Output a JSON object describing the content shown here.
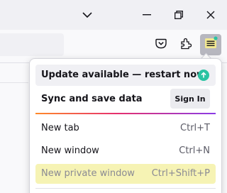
{
  "window_controls": {
    "items": [
      {
        "name": "list-all-tabs",
        "icon": "chevron-down-icon"
      },
      {
        "name": "minimize",
        "icon": "minimize-icon"
      },
      {
        "name": "restore",
        "icon": "restore-icon"
      },
      {
        "name": "close",
        "icon": "close-icon"
      }
    ]
  },
  "toolbar": {
    "buttons": [
      {
        "name": "pocket",
        "icon": "pocket-icon"
      },
      {
        "name": "extensions",
        "icon": "puzzle-icon"
      },
      {
        "name": "app-menu",
        "icon": "hamburger-menu-icon",
        "active": true,
        "badge_color": "#2ac3a2"
      }
    ]
  },
  "app_menu": {
    "update_label": "Update available — restart now",
    "sync_label": "Sync and save data",
    "sign_in_label": "Sign In",
    "items": [
      {
        "label": "New tab",
        "shortcut": "Ctrl+T",
        "highlighted": false
      },
      {
        "label": "New window",
        "shortcut": "Ctrl+N",
        "highlighted": false
      },
      {
        "label": "New private window",
        "shortcut": "Ctrl+Shift+P",
        "highlighted": true
      }
    ]
  },
  "colors": {
    "accent_update": "#2ac3a2",
    "highlight": "#f6f3b4",
    "active_button": "#b7b7bf",
    "gradient_start": "#ff8a2a",
    "gradient_mid": "#e6306e",
    "gradient_end": "#8a3be6"
  }
}
